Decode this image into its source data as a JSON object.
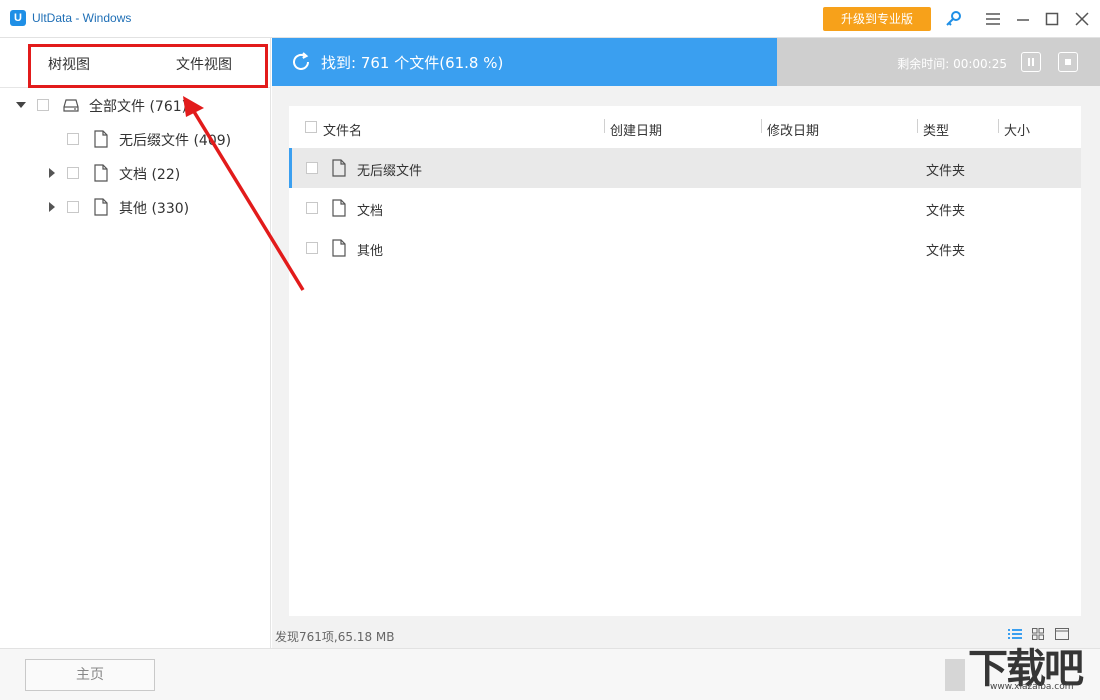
{
  "window": {
    "title": "UltData - Windows",
    "logo_letter": "U",
    "upgrade_label": "升级到专业版",
    "upgrade_color": "#f7a11a"
  },
  "left": {
    "tabs": [
      "树视图",
      "文件视图"
    ],
    "tree": [
      {
        "label": "全部文件 (761)",
        "icon": "drive-icon",
        "expanded": true
      },
      {
        "label": "无后缀文件 (409)",
        "icon": "file-icon"
      },
      {
        "label": "文档 (22)",
        "icon": "file-icon"
      },
      {
        "label": "其他 (330)",
        "icon": "file-icon"
      }
    ]
  },
  "scan": {
    "status_text": "找到: 761 个文件(61.8 %)",
    "progress": 0.618,
    "remaining_text": "剩余时间: 00:00:25",
    "accent": "#3a9ff0"
  },
  "table": {
    "headers": [
      "文件名",
      "创建日期",
      "修改日期",
      "类型",
      "大小"
    ],
    "rows": [
      {
        "name": "无后缀文件",
        "created": "",
        "modified": "",
        "type": "文件夹",
        "size": ""
      },
      {
        "name": "文档",
        "created": "",
        "modified": "",
        "type": "文件夹",
        "size": ""
      },
      {
        "name": "其他",
        "created": "",
        "modified": "",
        "type": "文件夹",
        "size": ""
      }
    ]
  },
  "footer": {
    "status": "发现761项,65.18 MB",
    "home_label": "主页"
  },
  "watermark": {
    "main": "下载吧",
    "sub": "www.xiazaiba.com"
  }
}
